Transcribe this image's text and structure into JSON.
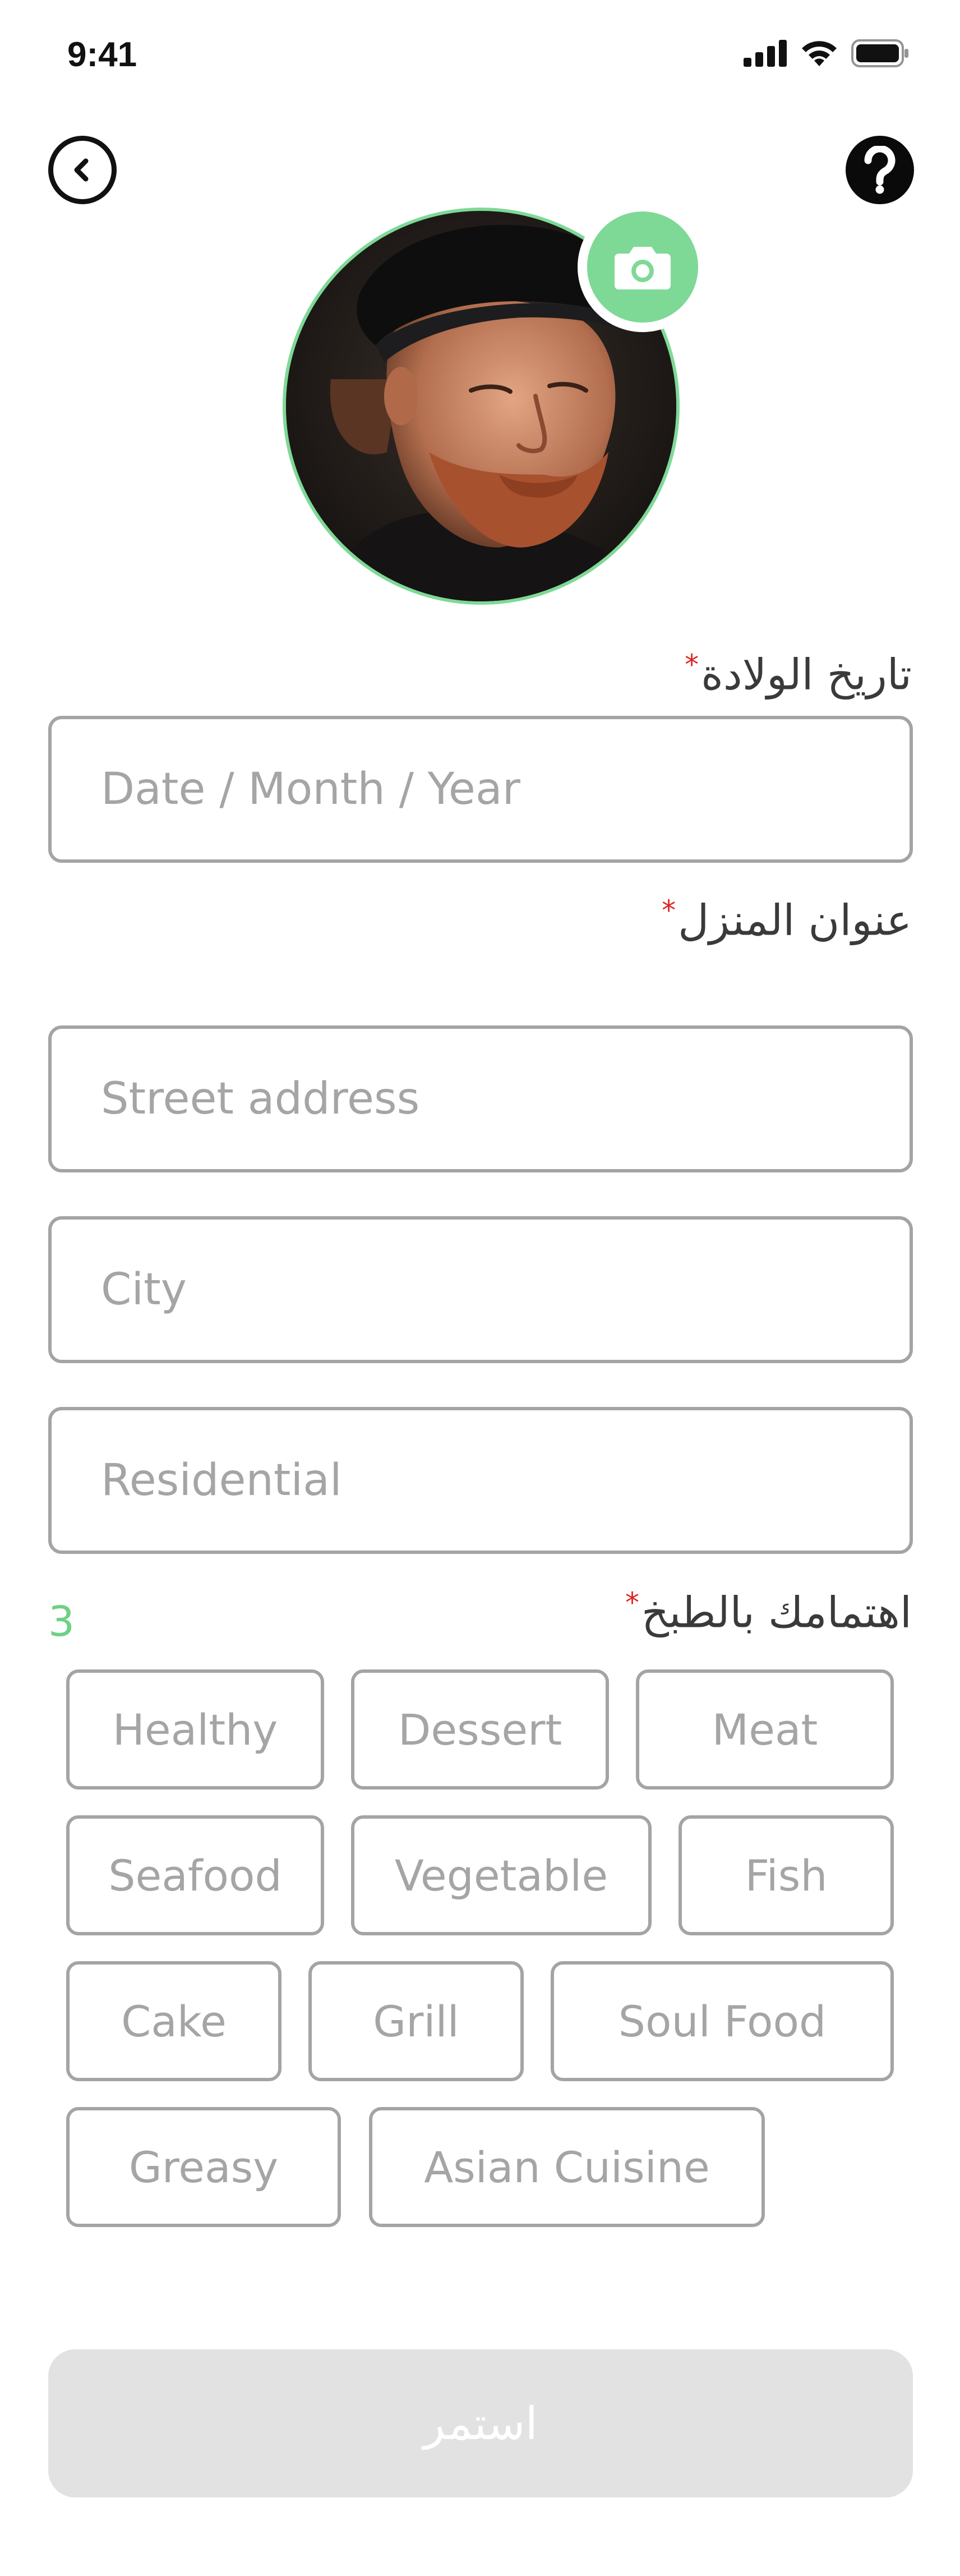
{
  "status_bar": {
    "time": "9:41",
    "icons": [
      "signal-icon",
      "wifi-icon",
      "battery-icon"
    ]
  },
  "nav": {
    "back_icon": "chevron-left-icon",
    "help_icon": "question-mark-icon"
  },
  "profile": {
    "camera_icon": "camera-icon",
    "accent_color": "#7ed996"
  },
  "form": {
    "birth_date": {
      "label": "تاريخ الولادة",
      "required_mark": "*",
      "placeholder": "Date / Month / Year"
    },
    "home_address": {
      "label": "عنوان المنزل",
      "required_mark": "*",
      "street_placeholder": "Street address",
      "city_placeholder": "City",
      "residential_placeholder": "Residential"
    },
    "cooking_interest": {
      "label": "اهتمامك بالطبخ",
      "required_mark": "*",
      "count": "3",
      "chips": [
        "Healthy",
        "Dessert",
        "Meat",
        "Seafood",
        "Vegetable",
        "Fish",
        "Cake",
        "Grill",
        "Soul Food",
        "Greasy",
        "Asian Cuisine"
      ]
    }
  },
  "continue_label": "استمر",
  "colors": {
    "accent": "#7ed996",
    "required": "#e02424",
    "border": "#a4a4a4",
    "placeholder": "#a5a5a5",
    "disabled_button": "#e2e2e2"
  }
}
